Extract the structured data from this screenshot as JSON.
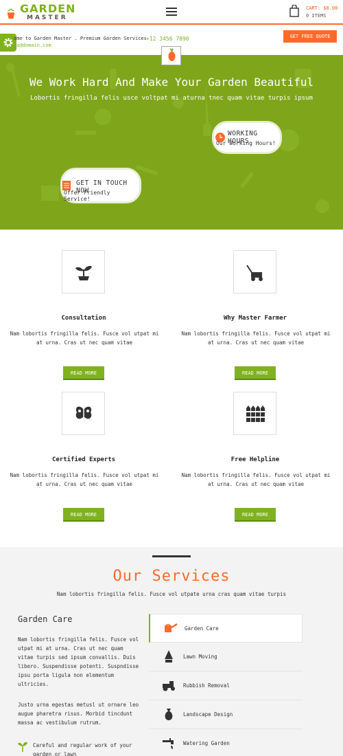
{
  "header": {
    "logo_top": "GARDEN",
    "logo_bottom": "MASTER",
    "cart_label": "CART: $0.00",
    "cart_items": "0 ITEMS"
  },
  "topbar": {
    "welcome": "ome to Garden Master . Premium Garden Services",
    "email": "fo@domain.com",
    "phone": "+12 3456 7890",
    "quote_button": "GET FREE QUOTE"
  },
  "hero": {
    "title": "We Work Hard And Make Your Garden Beautiful",
    "subtitle": "Lobortis fringilla felis usce voltpat mi aturna tnec quam vitae turpis ipsum",
    "working_title": "WORKING HOURS",
    "working_sub": "Our Working Hours!",
    "touch_title": "GET IN TOUCH NOW",
    "touch_sub": "Offer Friendly Service!"
  },
  "features": [
    {
      "title": "Consultation",
      "desc": "Nam lobortis fringilla felis. Fusce vol utpat mi at urna. Cras ut nec quam vitae",
      "button": "READ MORE",
      "icon": "sprout-icon"
    },
    {
      "title": "Why Master Farmer",
      "desc": "Nam lobortis fringilla felis. Fusce vol utpat mi at urna. Cras ut nec quam vitae",
      "button": "READ MORE",
      "icon": "lawnmower-icon"
    },
    {
      "title": "Certified Experts",
      "desc": "Nam lobortis fringilla felis. Fusce vol utpat mi at urna. Cras ut nec quam vitae",
      "button": "READ MORE",
      "icon": "butterfly-icon"
    },
    {
      "title": "Free Helpline",
      "desc": "Nam lobortis fringilla felis. Fusce vol utpat mi at urna. Cras ut nec quam vitae",
      "button": "READ MORE",
      "icon": "fence-icon"
    }
  ],
  "services": {
    "title": "Our Services",
    "subtitle": "Nam lobortis fringilla felis. Fusce vol utpate urna cras quam vitae turpis",
    "garden_care_title": "Garden Care",
    "para1": "Nam lobortis fringilla felis. Fusce vol utpat mi at urna. Cras ut nec quam vitae turpis sed ipsum convallis. Duis libero. Suspendisse potenti. Suspndisse ipsu porta ligula non elementum ultricies.",
    "para2": "Justo urna egestas metusl ut ornare leo augue pharetra risus. Morbid tincdunt massa ac vestibulum rutrum.",
    "item1": "Careful and regular work of your garden or lawn",
    "tabs": [
      {
        "label": "Garden Care",
        "icon": "watering-can-icon",
        "active": true
      },
      {
        "label": "Lawn Moving",
        "icon": "lamp-icon",
        "active": false
      },
      {
        "label": "Rubbish Removal",
        "icon": "tractor-icon",
        "active": false
      },
      {
        "label": "Landscape Design",
        "icon": "sack-icon",
        "active": false
      },
      {
        "label": "Watering Garden",
        "icon": "tap-icon",
        "active": false
      }
    ]
  },
  "colors": {
    "green": "#7fb21e",
    "orange": "#ff6a2a"
  }
}
